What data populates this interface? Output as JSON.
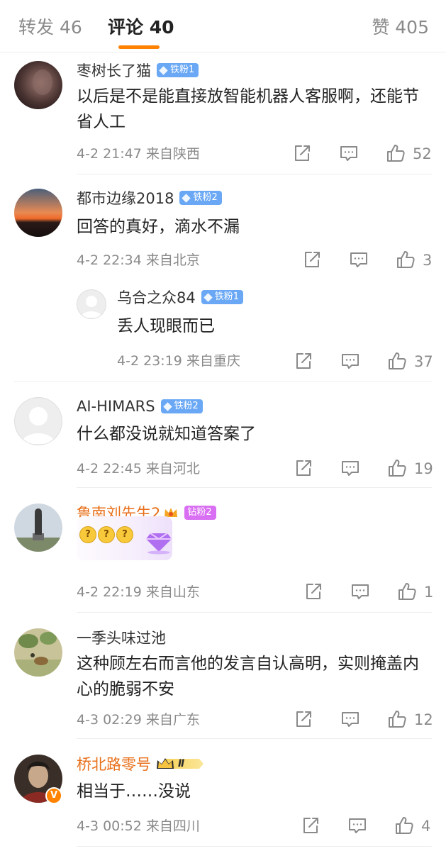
{
  "tabs": {
    "repost": "转发 46",
    "comment": "评论 40",
    "like": "赞 405"
  },
  "colors": {
    "accent": "#ff8200",
    "fan_blue": "#6aa8f5",
    "fan_pink": "#d96ff2",
    "vip_name": "#e86f1a"
  },
  "comments": [
    {
      "username": "枣树长了猫",
      "badge": "铁粉1",
      "text": "以后是不是能直接放智能机器人客服啊，还能节省人工",
      "time": "4-2 21:47",
      "location": "来自陕西",
      "likes": "52",
      "avatar_icon": "dark-photo-avatar"
    },
    {
      "username": "都市边缘2018",
      "badge": "铁粉2",
      "text": "回答的真好，滴水不漏",
      "time": "4-2 22:34",
      "location": "来自北京",
      "likes": "3",
      "avatar_icon": "sunset-avatar"
    },
    {
      "username": "乌合之众84",
      "badge": "铁粉1",
      "text": "丢人现眼而已",
      "time": "4-2 23:19",
      "location": "来自重庆",
      "likes": "37",
      "avatar_icon": "default-avatar",
      "is_reply": true
    },
    {
      "username": "AI-HIMARS",
      "badge": "铁粉2",
      "text": "什么都没说就知道答案了",
      "time": "4-2 22:45",
      "location": "来自河北",
      "likes": "19",
      "avatar_icon": "default-avatar"
    },
    {
      "username": "鲁南刘先生2",
      "badge": "钻粉2",
      "text": "",
      "time": "4-2 22:19",
      "location": "来自山东",
      "likes": "1",
      "avatar_icon": "statue-avatar",
      "emojis": [
        "confused-emoji",
        "confused-emoji",
        "confused-emoji"
      ]
    },
    {
      "username": "一季头味过池",
      "badge": "",
      "text": "这种顾左右而言他的发言自认高明，实则掩盖内心的脆弱不安",
      "time": "4-3 02:29",
      "location": "来自广东",
      "likes": "12",
      "avatar_icon": "painting-avatar"
    },
    {
      "username": "桥北路零号",
      "badge": "Ⅱ",
      "text": "相当于……没说",
      "time": "4-3 00:52",
      "location": "来自四川",
      "likes": "4",
      "avatar_icon": "portrait-avatar",
      "verified": "V"
    }
  ]
}
